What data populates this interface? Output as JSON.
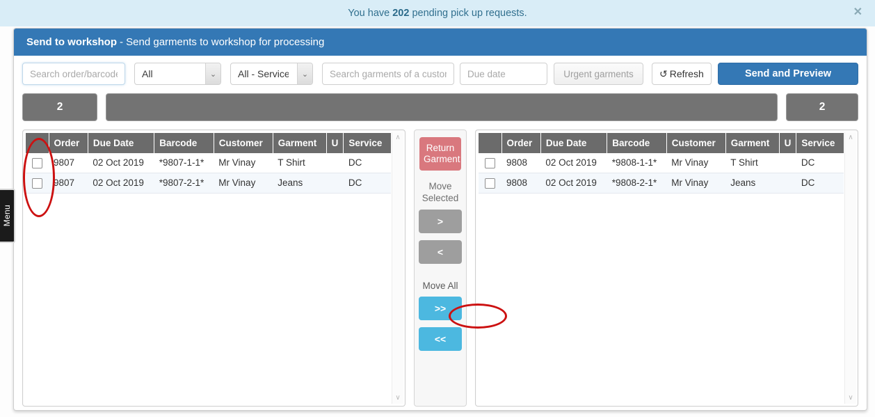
{
  "notification": {
    "prefix": "You have ",
    "count": "202",
    "suffix": " pending pick up requests.",
    "close_icon": "✕",
    "background": "#d9edf7",
    "text_color": "#31708f"
  },
  "menu_tab": {
    "label": "Menu"
  },
  "panel": {
    "title_strong": "Send to workshop",
    "title_rest": "- Send garments to workshop for processing",
    "header_color": "#3478b5"
  },
  "toolbar": {
    "order_search_placeholder": "Search order/barcode",
    "order_search_value": "",
    "status_select": {
      "selected": "All",
      "options": [
        "All"
      ]
    },
    "service_select": {
      "selected": "All - Services",
      "options": [
        "All - Services"
      ]
    },
    "customer_search_placeholder": "Search garments of a customer",
    "customer_search_value": "",
    "due_date_placeholder": "Due date",
    "due_date_value": "",
    "urgent_label": "Urgent garments",
    "refresh_icon": "↺",
    "refresh_label": "Refresh",
    "send_preview_label": "Send and Preview",
    "send_preview_color": "#3478b5",
    "dropdown_arrow_icon": "⌄"
  },
  "counts": {
    "left": "2",
    "middle": "",
    "right": "2"
  },
  "center_controls": {
    "return_garment_label": "Return Garment",
    "return_garment_color": "#d9787e",
    "move_selected_label": "Move Selected",
    "move_right_label": ">",
    "move_left_label": "<",
    "move_all_label": "Move All",
    "move_all_right_label": ">>",
    "move_all_left_label": "<<",
    "arrow_gray": "#9e9e9e",
    "arrow_blue": "#4cb8e0"
  },
  "left_table": {
    "columns": [
      "",
      "Order",
      "Due Date",
      "Barcode",
      "Customer",
      "Garment",
      "U",
      "Service"
    ],
    "rows": [
      {
        "checked": false,
        "order": "9807",
        "due_date": "02 Oct 2019",
        "barcode": "*9807-1-1*",
        "customer": "Mr Vinay",
        "garment": "T Shirt",
        "u": "",
        "service": "DC"
      },
      {
        "checked": false,
        "order": "9807",
        "due_date": "02 Oct 2019",
        "barcode": "*9807-2-1*",
        "customer": "Mr Vinay",
        "garment": "Jeans",
        "u": "",
        "service": "DC"
      }
    ]
  },
  "right_table": {
    "columns": [
      "",
      "Order",
      "Due Date",
      "Barcode",
      "Customer",
      "Garment",
      "U",
      "Service"
    ],
    "rows": [
      {
        "checked": false,
        "order": "9808",
        "due_date": "02 Oct 2019",
        "barcode": "*9808-1-1*",
        "customer": "Mr Vinay",
        "garment": "T Shirt",
        "u": "",
        "service": "DC"
      },
      {
        "checked": false,
        "order": "9808",
        "due_date": "02 Oct 2019",
        "barcode": "*9808-2-1*",
        "customer": "Mr Vinay",
        "garment": "Jeans",
        "u": "",
        "service": "DC"
      }
    ]
  },
  "scrollbar": {
    "up_icon": "∧",
    "down_icon": "∨"
  },
  "annotations": {
    "color": "#cc1111"
  }
}
